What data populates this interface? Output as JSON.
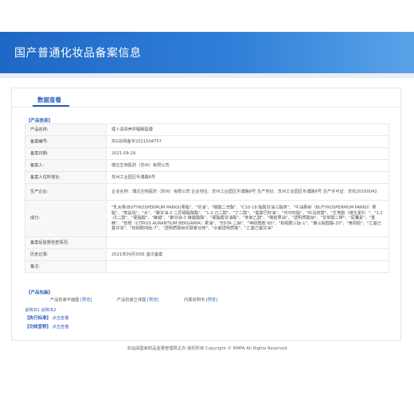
{
  "header": {
    "title": "国产普通化妆品备案信息"
  },
  "tab": {
    "label": "数据查看"
  },
  "sections": {
    "product_info": "【产品信息】",
    "packaging": "【产品包装】",
    "standard": "【执行标准】",
    "efficacy": "【功效宣称】"
  },
  "rows": [
    {
      "label": "产品名称:",
      "value": "理卜润泽养护睡眠唇膜"
    },
    {
      "label": "备案编号:",
      "value": "苏G妆网备字2021504757"
    },
    {
      "label": "备案日期:",
      "value": "2021-09-29"
    },
    {
      "label": "备案人:",
      "value": "傅达生物医药（苏州）有限公司"
    },
    {
      "label": "备案人住所地址:",
      "value": "苏州工业园区圻濮路8号"
    },
    {
      "label": "生产企业:",
      "value": "企业名称：傅达生物医药（苏州）有限公司 企业地址：苏州工业园区圻濮路8号 生产地址：苏州工业园区圻濮路8号 生产许可证：苏妆20160042"
    },
    {
      "label": "成分:",
      "value": "\"乳木果(BUTYROSPERMUM PARKII)果脂\"、\"甘油\"、\"碳酸二辛酯\"、\"C10-18 脂酸甘油三酯类\"、\"牛油果树（BUTYROSPERMUM PARKII）果脂\"、\"角鲨烷\"、\"水\"、\"聚甘油-2 二异硬脂酸酯\"、\"1,2-己二醇\"、\"丁二醇\"、\"霍霍巴籽油\"、\"可可籽脂\"、\"红没药醇\"、\"生育酚（维生素E）\"、\"1,2-戊二醇\"、\"硬脂酸\"、\"蜂蜡\"、\"聚甘油-3 蜂蜡酸酯\"、\"硬脂酸甘油酯\"、\"苯氧乙醇\"、\"橄榄果油\"、\"透明质酸钠\"、\"甘草酸二钾\"、\"尿囊素\"、\"香精\"、\"苦橙（CITRUS AURANTIUM BERGAMIA）果油\"、\"EDTA 二钠\"、\"神经酰胺 NS\"、\"棕榈酰三肽-1\"、\"聚山梨醇酯-20\"、\"黄原胶\"、\"乙基己基甘油\"、\"棕榈酰四肽-7\"、\"透明质酸钠交联聚合物\"、\"水解透明质酸\"、\"乙基己基甘油\""
    },
    {
      "label": "备案后监督检查情况:",
      "value": ""
    },
    {
      "label": "历史记录:",
      "value": "2021年09月30日 首次备案"
    },
    {
      "label": "备注:",
      "value": ""
    }
  ],
  "packaging": {
    "flat_label": "产品包装平面图",
    "flat_link": "[预览]",
    "solid_label": "产品包装立体图",
    "solid_link": "[预览]",
    "manual_label": "内置说明书",
    "manual_link": "[预览]",
    "manual_links": "说明书1 说明书2"
  },
  "standard": {
    "link": "点击查看"
  },
  "efficacy": {
    "link": "点击查看"
  },
  "footer": {
    "text": "本站由国家药品监督管理局主办 版权所有 Copyright © NMPA All Rights Reserved"
  }
}
